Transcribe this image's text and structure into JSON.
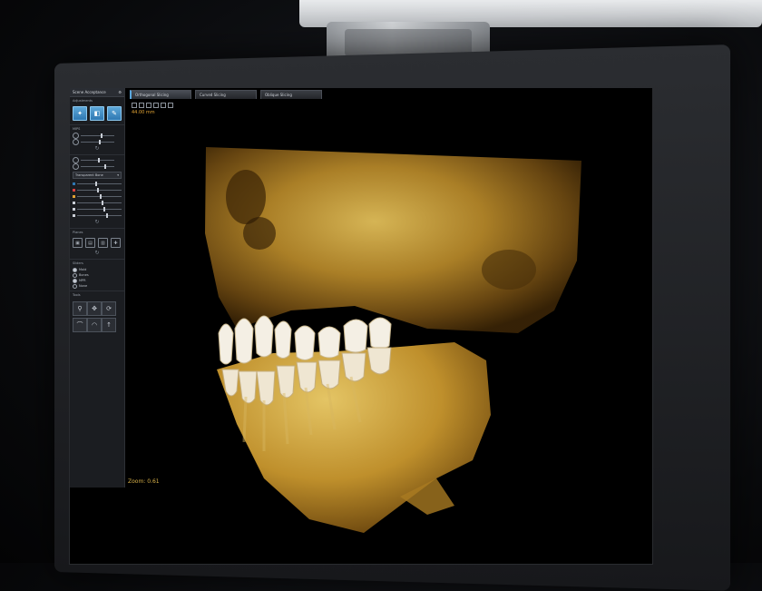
{
  "panel": {
    "header_title": "Scene Acceptance",
    "adjustments_title": "Adjustments",
    "mips_title": "MIPS",
    "planes_title": "Planes",
    "sliders_title": "Sliders",
    "tools_title": "Tools",
    "dropdown_value": "Transparent Bone",
    "colors": [
      "#2f78b2",
      "#d93f3f",
      "#e0a233",
      "#c9ced6",
      "#c9ced6",
      "#c9ced6"
    ],
    "radio_1": "Mold",
    "radio_2": "Bones",
    "radio_3": "MPR",
    "radio_4": "None"
  },
  "tabs": [
    {
      "label": "Orthogonal Slicing"
    },
    {
      "label": "Curved Slicing"
    },
    {
      "label": "Oblique Slicing"
    }
  ],
  "viewer": {
    "measurement": "44.00 mm",
    "zoom": "Zoom: 0.61"
  }
}
